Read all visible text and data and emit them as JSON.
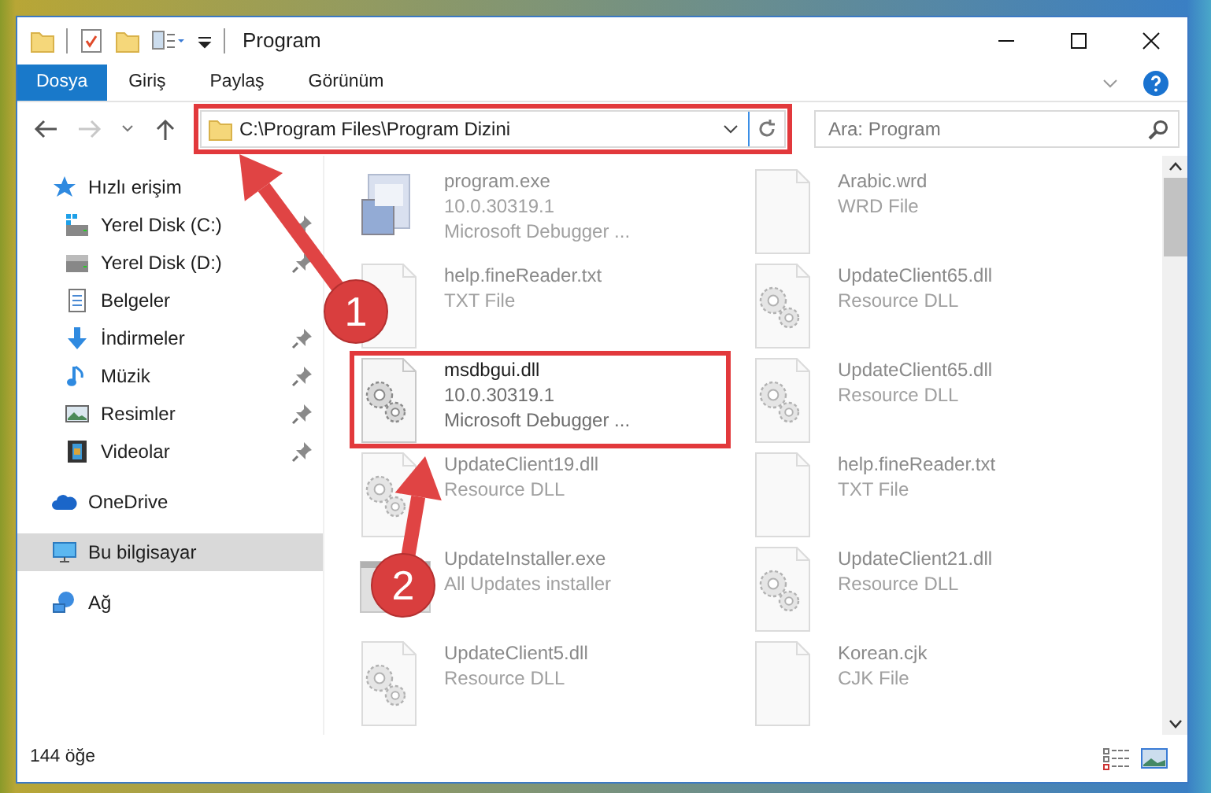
{
  "window": {
    "title": "Program"
  },
  "ribbon_tabs": [
    {
      "label": "Dosya",
      "kind": "file"
    },
    {
      "label": "Giriş",
      "kind": "tab"
    },
    {
      "label": "Paylaş",
      "kind": "tab"
    },
    {
      "label": "Görünüm",
      "kind": "tab"
    }
  ],
  "navigation": {
    "forward_disabled": true
  },
  "address_bar": {
    "path": "C:\\Program Files\\Program Dizini",
    "highlighted": true
  },
  "search": {
    "placeholder": "Ara: Program"
  },
  "sidebar": {
    "items": [
      {
        "label": "Hızlı erişim",
        "kind": "quick",
        "selected": false,
        "children": [
          {
            "label": "Yerel Disk (C:)",
            "kind": "drive-c",
            "pinned": true,
            "selected": false
          },
          {
            "label": "Yerel Disk (D:)",
            "kind": "drive",
            "pinned": true,
            "selected": false
          },
          {
            "label": "Belgeler",
            "kind": "documents",
            "pinned": false,
            "selected": false
          },
          {
            "label": "İndirmeler",
            "kind": "downloads",
            "pinned": true,
            "selected": false
          },
          {
            "label": "Müzik",
            "kind": "music",
            "pinned": true,
            "selected": false
          },
          {
            "label": "Resimler",
            "kind": "pictures",
            "pinned": true,
            "selected": false
          },
          {
            "label": "Videolar",
            "kind": "videos",
            "pinned": true,
            "selected": false
          }
        ]
      },
      {
        "label": "OneDrive",
        "kind": "cloud",
        "selected": false
      },
      {
        "label": "Bu bilgisayar",
        "kind": "computer",
        "selected": true
      },
      {
        "label": "Ağ",
        "kind": "network",
        "selected": false
      }
    ]
  },
  "files": [
    {
      "name": "program.exe",
      "line_2": "10.0.30319.1",
      "line_3": "Microsoft Debugger ...",
      "kind": "exe",
      "blurred": true,
      "highlighted": false
    },
    {
      "name": "Arabic.wrd",
      "line_2": "WRD File",
      "kind": "file",
      "blurred": true,
      "highlighted": false
    },
    {
      "name": "help.fineReader.txt",
      "line_2": "TXT File",
      "kind": "txt",
      "blurred": true,
      "highlighted": false
    },
    {
      "name": "UpdateClient65.dll",
      "line_2": "Resource DLL",
      "kind": "dll",
      "blurred": true,
      "highlighted": false
    },
    {
      "name": "msdbgui.dll",
      "line_2": "10.0.30319.1",
      "line_3": "Microsoft Debugger ...",
      "kind": "dll",
      "blurred": false,
      "highlighted": true
    },
    {
      "name": "UpdateClient65.dll",
      "line_2": "Resource DLL",
      "kind": "dll",
      "blurred": true,
      "highlighted": false
    },
    {
      "name": "UpdateClient19.dll",
      "line_2": "Resource DLL",
      "kind": "dll",
      "blurred": true,
      "highlighted": false
    },
    {
      "name": "help.fineReader.txt",
      "line_2": "TXT File",
      "kind": "txt",
      "blurred": true,
      "highlighted": false
    },
    {
      "name": "UpdateInstaller.exe",
      "line_2": "All Updates installer",
      "kind": "installer",
      "blurred": true,
      "highlighted": false
    },
    {
      "name": "UpdateClient21.dll",
      "line_2": "Resource DLL",
      "kind": "dll",
      "blurred": true,
      "highlighted": false
    },
    {
      "name": "UpdateClient5.dll",
      "line_2": "Resource DLL",
      "kind": "dll",
      "blurred": true,
      "highlighted": false
    },
    {
      "name": "Korean.cjk",
      "line_2": "CJK File",
      "kind": "file",
      "blurred": true,
      "highlighted": false
    }
  ],
  "status_bar": {
    "item_count": "144 öğe"
  },
  "annotations": [
    {
      "number": "1"
    },
    {
      "number": "2"
    }
  ]
}
